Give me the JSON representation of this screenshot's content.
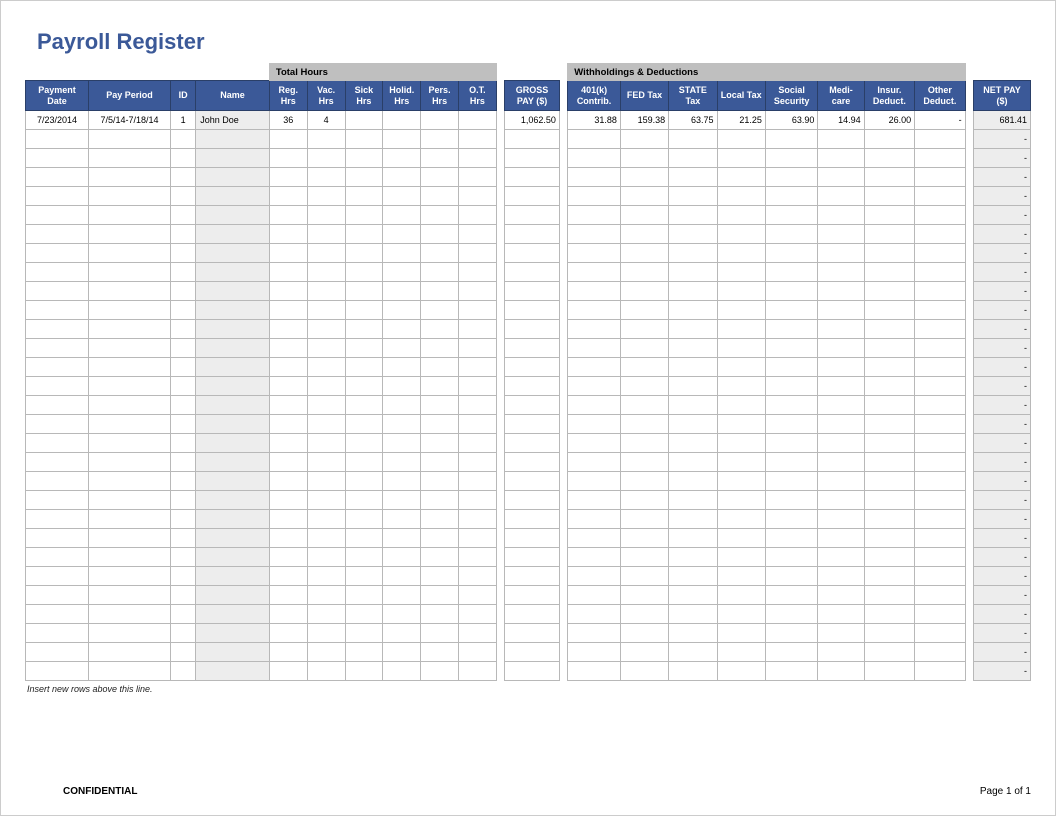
{
  "title": "Payroll Register",
  "sections": {
    "hours": "Total Hours",
    "deductions": "Withholdings & Deductions"
  },
  "columns": {
    "payment_date": "Payment Date",
    "pay_period": "Pay Period",
    "id": "ID",
    "name": "Name",
    "reg_hrs": "Reg. Hrs",
    "vac_hrs": "Vac. Hrs",
    "sick_hrs": "Sick Hrs",
    "holid_hrs": "Holid. Hrs",
    "pers_hrs": "Pers. Hrs",
    "ot_hrs": "O.T. Hrs",
    "gross_pay": "GROSS PAY ($)",
    "k401": "401(k) Contrib.",
    "fed_tax": "FED Tax",
    "state_tax": "STATE Tax",
    "local_tax": "Local Tax",
    "soc_sec": "Social Security",
    "medicare": "Medi-care",
    "insur": "Insur. Deduct.",
    "other": "Other Deduct.",
    "net_pay": "NET PAY ($)"
  },
  "rows": [
    {
      "payment_date": "7/23/2014",
      "pay_period": "7/5/14-7/18/14",
      "id": "1",
      "name": "John Doe",
      "reg_hrs": "36",
      "vac_hrs": "4",
      "sick_hrs": "",
      "holid_hrs": "",
      "pers_hrs": "",
      "ot_hrs": "",
      "gross_pay": "1,062.50",
      "k401": "31.88",
      "fed_tax": "159.38",
      "state_tax": "63.75",
      "local_tax": "21.25",
      "soc_sec": "63.90",
      "medicare": "14.94",
      "insur": "26.00",
      "other": "-",
      "net_pay": "681.41"
    }
  ],
  "empty_row_count": 29,
  "note": "Insert new rows above this line.",
  "footer": {
    "confidential": "CONFIDENTIAL",
    "page": "Page 1 of 1"
  },
  "dash": "-"
}
